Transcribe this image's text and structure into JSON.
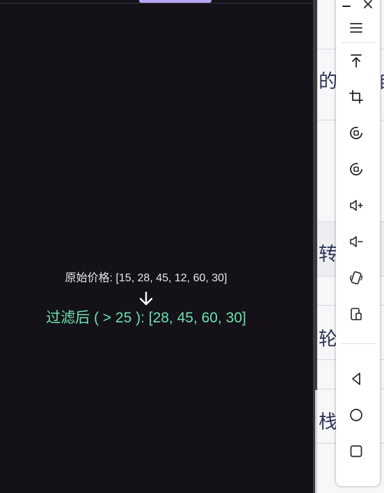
{
  "screen": {
    "original_label": "原始价格: [15, 28, 45, 12, 60, 30]",
    "filtered_label": "过滤后 ( > 25 ): [28, 45, 60, 30]",
    "colors": {
      "background": "#141218",
      "filtered_text": "#6fe0b0",
      "indicator": "#b7a6f0"
    }
  },
  "background_doc": {
    "rows": [
      {
        "text": "的",
        "text_right": "目"
      },
      {
        "text": "",
        "text_right": ""
      },
      {
        "text": "转",
        "text_right": ""
      },
      {
        "text": "轮",
        "text_right": ""
      },
      {
        "text": "栈",
        "text_right": ""
      }
    ]
  },
  "toolbar": {
    "icons": [
      "minimize-icon",
      "close-icon",
      "menu-icon",
      "pin-top-icon",
      "crop-icon",
      "rotate-left-icon",
      "rotate-right-icon",
      "volume-up-icon",
      "volume-down-icon",
      "shake-icon",
      "fold-icon",
      "back-icon",
      "home-icon",
      "overview-icon"
    ]
  }
}
